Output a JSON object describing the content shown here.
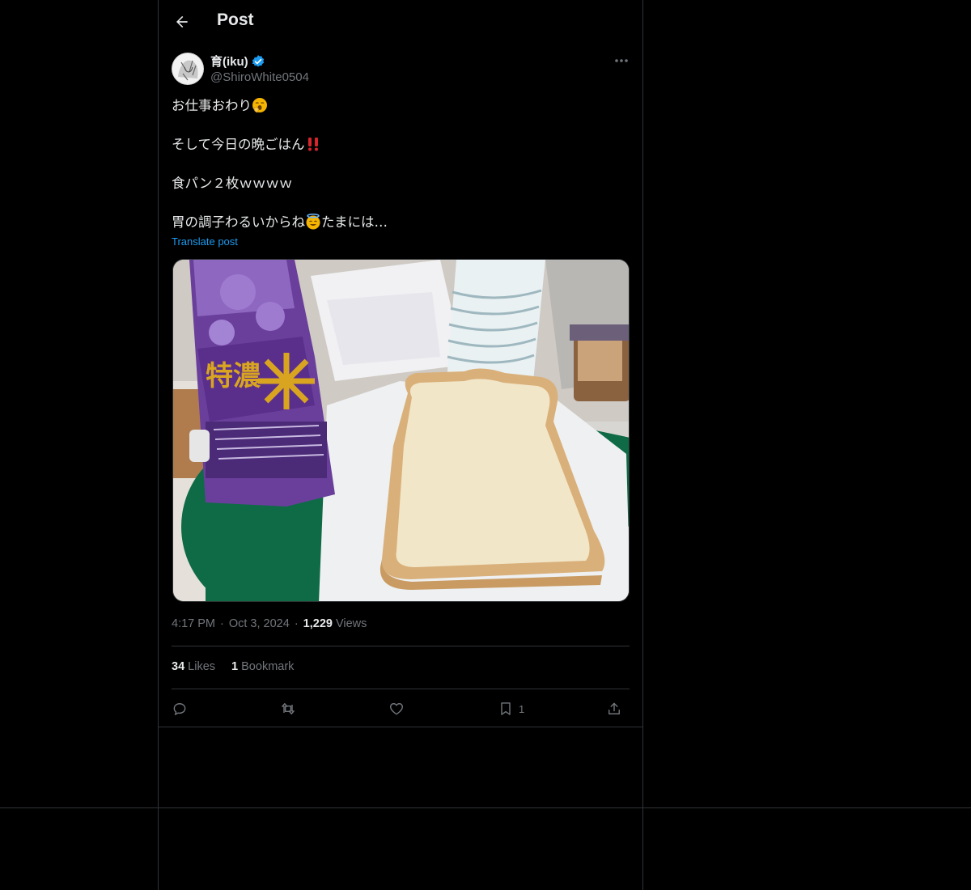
{
  "header": {
    "title": "Post"
  },
  "author": {
    "name": "育(iku)",
    "handle": "@ShiroWhite0504"
  },
  "tweet": {
    "lines": [
      "お仕事おわり",
      "そして今日の晩ごはん",
      "食パン２枚ｗｗｗｗ",
      "胃の調子わるいからね",
      "たまには…"
    ],
    "translate_label": "Translate post"
  },
  "meta": {
    "time": "4:17 PM",
    "date": "Oct 3, 2024",
    "views_count": "1,229",
    "views_label": "Views",
    "dot": "·"
  },
  "stats": {
    "likes_count": "34",
    "likes_label": "Likes",
    "bookmarks_count": "1",
    "bookmarks_label": "Bookmark"
  },
  "actions": {
    "bookmark_count": "1"
  },
  "colors": {
    "background": "#000000",
    "text": "#e7e9ea",
    "muted": "#71767b",
    "accent": "#1d9bf0",
    "border": "#2f3336"
  },
  "icons": [
    "back-arrow-icon",
    "verified-badge-icon",
    "more-icon",
    "reply-icon",
    "retweet-icon",
    "like-icon",
    "bookmark-icon",
    "share-icon"
  ]
}
